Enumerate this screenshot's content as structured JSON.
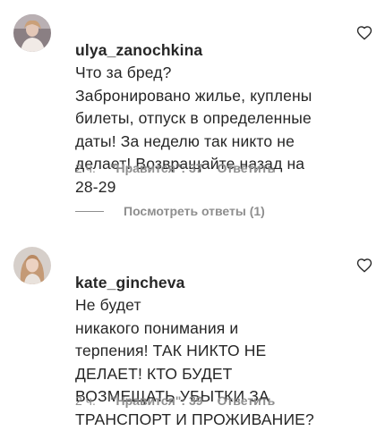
{
  "comments": [
    {
      "username": "ulya_zanochkina",
      "text": "Что за бред?\nЗабронировано жилье, куплены\nбилеты, отпуск в определенные\nдаты! За неделю так никто не\nделает! Возвращайте назад на\n28-29",
      "time": "2 ч.",
      "likes": "\"Нравится\": 37",
      "reply": "Ответить"
    },
    {
      "username": "kate_gincheva",
      "text": "Не будет\nникакого понимания и\nтерпения! ТАК НИКТО НЕ\nДЕЛАЕТ! КТО БУДЕТ\nВОЗМЕЩАТЬ УБЫТКИ ЗА\nТРАНСПОРТ И ПРОЖИВАНИЕ?",
      "time": "2 ч.",
      "likes": "\"Нравится\": 39",
      "reply": "Ответить"
    }
  ],
  "view_replies": "Посмотреть ответы (1)",
  "colors": {
    "text": "#262626",
    "secondary": "#8e8e8e"
  },
  "icons": {
    "like": "heart-outline-icon"
  }
}
